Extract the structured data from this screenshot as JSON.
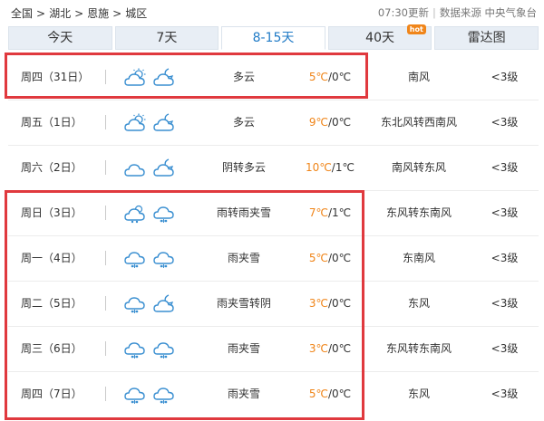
{
  "breadcrumb": [
    "全国",
    "湖北",
    "恩施",
    "城区"
  ],
  "breadcrumb_sep": ">",
  "update_time": "07:30更新",
  "source": "数据来源 中央气象台",
  "meta_sep": "|",
  "tabs": [
    {
      "label": "今天"
    },
    {
      "label": "7天"
    },
    {
      "label": "8-15天",
      "active": true
    },
    {
      "label": "40天",
      "badge": "hot"
    },
    {
      "label": "雷达图"
    }
  ],
  "colors": {
    "accent": "#1f7ac6",
    "high_temp": "#f08519",
    "highlight_box": "#e0393e"
  },
  "forecast": [
    {
      "day": "周四（31日）",
      "icons": [
        "partly-cloudy-icon",
        "moon-cloud-icon"
      ],
      "desc": "多云",
      "high": "5℃",
      "low": "/0℃",
      "wind": "南风",
      "level": "<3级"
    },
    {
      "day": "周五（1日）",
      "icons": [
        "partly-cloudy-icon",
        "moon-cloud-icon"
      ],
      "desc": "多云",
      "high": "9℃",
      "low": "/0℃",
      "wind": "东北风转西南风",
      "level": "<3级"
    },
    {
      "day": "周六（2日）",
      "icons": [
        "cloudy-icon",
        "moon-cloud-icon"
      ],
      "desc": "阴转多云",
      "high": "10℃",
      "low": "/1℃",
      "wind": "南风转东风",
      "level": "<3级"
    },
    {
      "day": "周日（3日）",
      "icons": [
        "rain-cloud-icon",
        "sleet-cloud-icon"
      ],
      "desc": "雨转雨夹雪",
      "high": "7℃",
      "low": "/1℃",
      "wind": "东风转东南风",
      "level": "<3级"
    },
    {
      "day": "周一（4日）",
      "icons": [
        "sleet-cloud-icon",
        "sleet-cloud-icon"
      ],
      "desc": "雨夹雪",
      "high": "5℃",
      "low": "/0℃",
      "wind": "东南风",
      "level": "<3级"
    },
    {
      "day": "周二（5日）",
      "icons": [
        "sleet-cloud-icon",
        "moon-cloud-icon"
      ],
      "desc": "雨夹雪转阴",
      "high": "3℃",
      "low": "/0℃",
      "wind": "东风",
      "level": "<3级"
    },
    {
      "day": "周三（6日）",
      "icons": [
        "sleet-cloud-icon",
        "sleet-cloud-icon"
      ],
      "desc": "雨夹雪",
      "high": "3℃",
      "low": "/0℃",
      "wind": "东风转东南风",
      "level": "<3级"
    },
    {
      "day": "周四（7日）",
      "icons": [
        "sleet-cloud-icon",
        "sleet-cloud-icon"
      ],
      "desc": "雨夹雪",
      "high": "5℃",
      "low": "/0℃",
      "wind": "东风",
      "level": "<3级"
    }
  ]
}
